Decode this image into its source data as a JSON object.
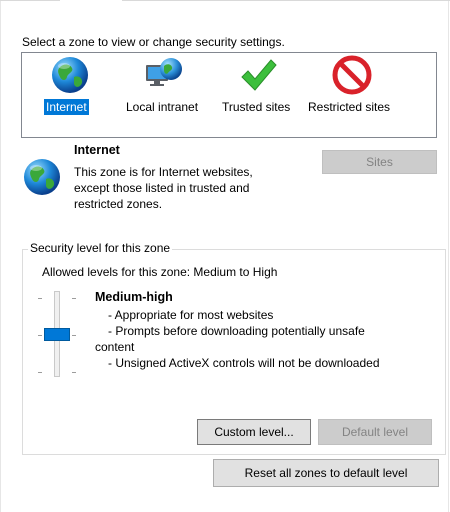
{
  "zones": {
    "prompt": "Select a zone to view or change security settings.",
    "items": [
      {
        "label": "Internet",
        "icon": "globe-icon",
        "selected": true
      },
      {
        "label": "Local intranet",
        "icon": "intranet-icon",
        "selected": false
      },
      {
        "label": "Trusted sites",
        "icon": "checkmark-icon",
        "selected": false
      },
      {
        "label": "Restricted sites",
        "icon": "restricted-icon",
        "selected": false
      }
    ]
  },
  "selected_zone": {
    "title": "Internet",
    "description": "This zone is for Internet websites, except those listed in trusted and restricted zones.",
    "sites_button": "Sites"
  },
  "security_level": {
    "group_label": "Security level for this zone",
    "allowed_levels": "Allowed levels for this zone: Medium to High",
    "slider_level_label": "Medium-high",
    "slider_value": "2 of 3 (levels: Medium, Medium-high, High)",
    "bullets": [
      "- Appropriate for most websites",
      "- Prompts before downloading potentially unsafe",
      "content",
      "- Unsigned ActiveX controls will not be downloaded"
    ],
    "custom_level_button": "Custom level...",
    "default_level_button": "Default level"
  },
  "reset_all_button": "Reset all zones to default level",
  "colors": {
    "accent": "#0078d7",
    "disabled_text": "#838383"
  }
}
